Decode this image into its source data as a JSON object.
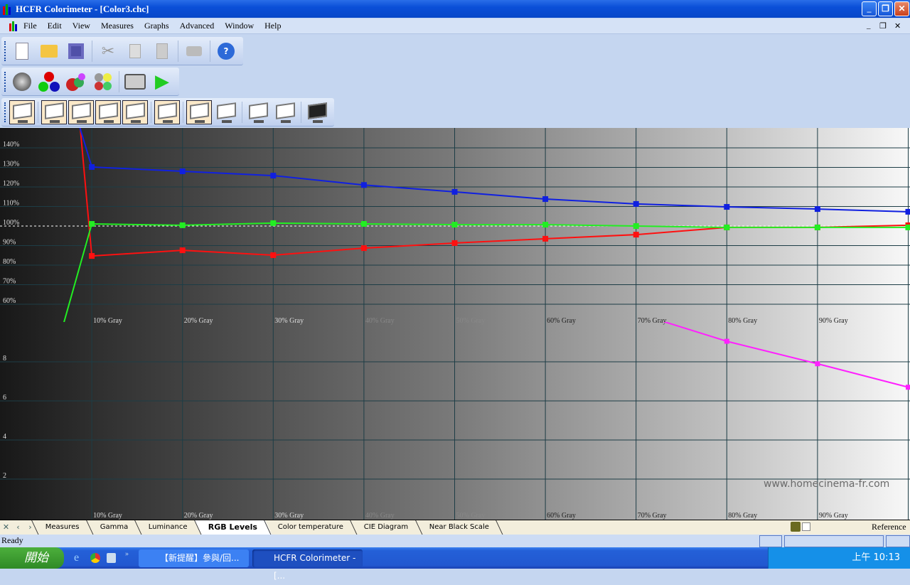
{
  "window": {
    "title": "HCFR Colorimeter - [Color3.chc]"
  },
  "menu": [
    "File",
    "Edit",
    "View",
    "Measures",
    "Graphs",
    "Advanced",
    "Window",
    "Help"
  ],
  "tabs": [
    "Measures",
    "Gamma",
    "Luminance",
    "RGB Levels",
    "Color temperature",
    "CIE Diagram",
    "Near Black Scale"
  ],
  "active_tab": "RGB Levels",
  "tabs_right_label": "Reference",
  "status": "Ready",
  "watermark": "www.homecinema-fr.com",
  "taskbar": {
    "start": "開始",
    "tasks": [
      "【新提醒】參與/回...",
      "HCFR Colorimeter - [..."
    ],
    "clock": "上午 10:13"
  },
  "colors": {
    "red": "#ff1010",
    "green": "#22ee22",
    "blue": "#1020e0",
    "magenta": "#ff20ff"
  },
  "chart_data": {
    "type": "line",
    "title": "RGB Levels",
    "x": [
      0,
      10,
      20,
      30,
      40,
      50,
      60,
      70,
      80,
      90,
      100
    ],
    "x_tick_labels": [
      "10% Gray",
      "20% Gray",
      "30% Gray",
      "40% Gray",
      "50% Gray",
      "60% Gray",
      "70% Gray",
      "80% Gray",
      "90% Gray"
    ],
    "upper": {
      "ylim": [
        50,
        150
      ],
      "y_tick_labels": [
        "140%",
        "130%",
        "120%",
        "110%",
        "100%",
        "90%",
        "80%",
        "70%",
        "60%"
      ],
      "reference": 100,
      "series": [
        {
          "name": "Red",
          "values": [
            600,
            84.7,
            87.6,
            85.1,
            88.7,
            91.3,
            93.5,
            95.6,
            99.3,
            99.3,
            100.4
          ]
        },
        {
          "name": "Green",
          "values": [
            -63,
            101.1,
            100.4,
            101.5,
            101.1,
            100.7,
            100.7,
            100,
            99.3,
            99.3,
            99.3
          ]
        },
        {
          "name": "Blue",
          "values": [
            284,
            130.2,
            128,
            125.8,
            121,
            117.5,
            113.8,
            111.3,
            109.8,
            108.7,
            107.3
          ]
        }
      ]
    },
    "lower": {
      "ylim": [
        0,
        10
      ],
      "y_tick_labels": [
        "8",
        "6",
        "4",
        "2"
      ],
      "series": [
        {
          "name": "Delta E",
          "x": [
            70,
            80,
            90,
            100
          ],
          "values": [
            10.5,
            9.05,
            7.9,
            6.7
          ]
        }
      ]
    }
  }
}
